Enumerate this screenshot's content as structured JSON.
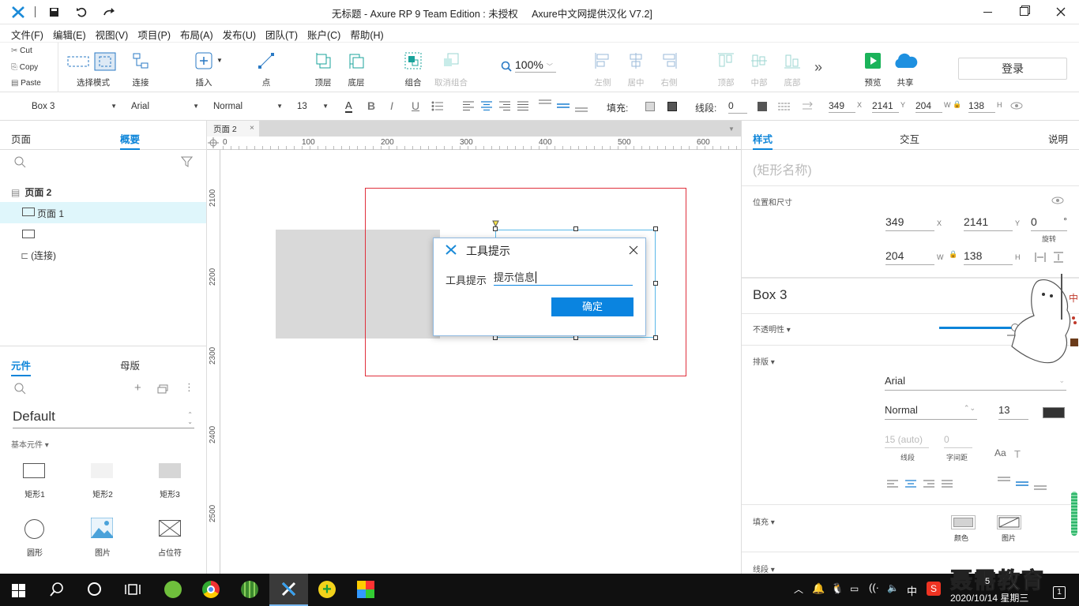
{
  "window": {
    "title": "无标题 - Axure RP 9 Team Edition : 未授权     Axure中文网提供汉化 V7.2]",
    "controls": [
      "minimize-icon",
      "maximize-icon",
      "close-icon"
    ]
  },
  "menu": [
    "文件(F)",
    "编辑(E)",
    "视图(V)",
    "项目(P)",
    "布局(A)",
    "发布(U)",
    "团队(T)",
    "账户(C)",
    "帮助(H)"
  ],
  "clipboard": {
    "cut": "Cut",
    "copy": "Copy",
    "paste": "Paste"
  },
  "toolbar": {
    "select_mode": "选择模式",
    "connect": "连接",
    "insert": "插入",
    "point": "点",
    "top": "顶层",
    "bottom": "底层",
    "group": "组合",
    "ungroup": "取消组合",
    "zoom": "100%",
    "align_left": "左侧",
    "align_center": "居中",
    "align_right": "右侧",
    "align_top": "顶部",
    "align_middle": "中部",
    "align_bottom": "底部",
    "more": "»",
    "preview": "预览",
    "share": "共享",
    "login": "登录"
  },
  "format": {
    "widget": "Box 3",
    "font": "Arial",
    "style": "Normal",
    "size": "13",
    "fill_label": "填充:",
    "line_label": "线段:",
    "line_value": "0",
    "x": "349",
    "y": "2141",
    "w": "204",
    "h": "138",
    "x_label": "X",
    "y_label": "Y",
    "w_label": "W",
    "h_label": "H"
  },
  "left": {
    "tabs": [
      "页面",
      "概要"
    ],
    "outline": {
      "page": "页面 2",
      "items": [
        "页面 1",
        "",
        "(连接)"
      ]
    },
    "lib_tabs": [
      "元件",
      "母版"
    ],
    "library": "Default",
    "category": "基本元件 ▾",
    "widgets": [
      "矩形1",
      "矩形2",
      "矩形3",
      "圆形",
      "图片",
      "占位符"
    ]
  },
  "canvas": {
    "tab": "页面 2",
    "ruler_h": [
      "0",
      "100",
      "200",
      "300",
      "400",
      "500",
      "600"
    ],
    "ruler_v": [
      "2100",
      "2200",
      "2300",
      "2400",
      "2500"
    ]
  },
  "dialog": {
    "title": "工具提示",
    "label": "工具提示",
    "value": "提示信息",
    "ok": "确定"
  },
  "right": {
    "tabs": [
      "样式",
      "交互",
      "说明"
    ],
    "name_placeholder": "(矩形名称)",
    "pos_size": "位置和尺寸",
    "x": "349",
    "y": "2141",
    "rotate": "0",
    "rotate_unit": "°",
    "rotate_label": "旋转",
    "w": "204",
    "h": "138",
    "x_label": "X",
    "y_label": "Y",
    "w_label": "W",
    "h_label": "H",
    "widget_name": "Box 3",
    "opacity": "不透明性 ▾",
    "opacity_value": 0.95,
    "typography": "排版 ▾",
    "font": "Arial",
    "style": "Normal",
    "size": "13",
    "line_spacing": "15 (auto)",
    "line_spacing_label": "线段",
    "char_spacing": "0",
    "char_spacing_label": "字间距",
    "fill": "填充 ▾",
    "fill_color": "颜色",
    "fill_image": "图片",
    "line": "线段 ▾"
  },
  "taskbar": {
    "date": "2020/10/14 星期三",
    "time_partial": "5",
    "ime": "中",
    "notification_count": "1",
    "watermark": "聂需教育"
  },
  "colors": {
    "accent": "#0b84d9",
    "selection_red": "#e0303c",
    "dialog_button": "#0a84e0",
    "gray_box": "#d9d9d9",
    "taskbar": "#101010"
  }
}
